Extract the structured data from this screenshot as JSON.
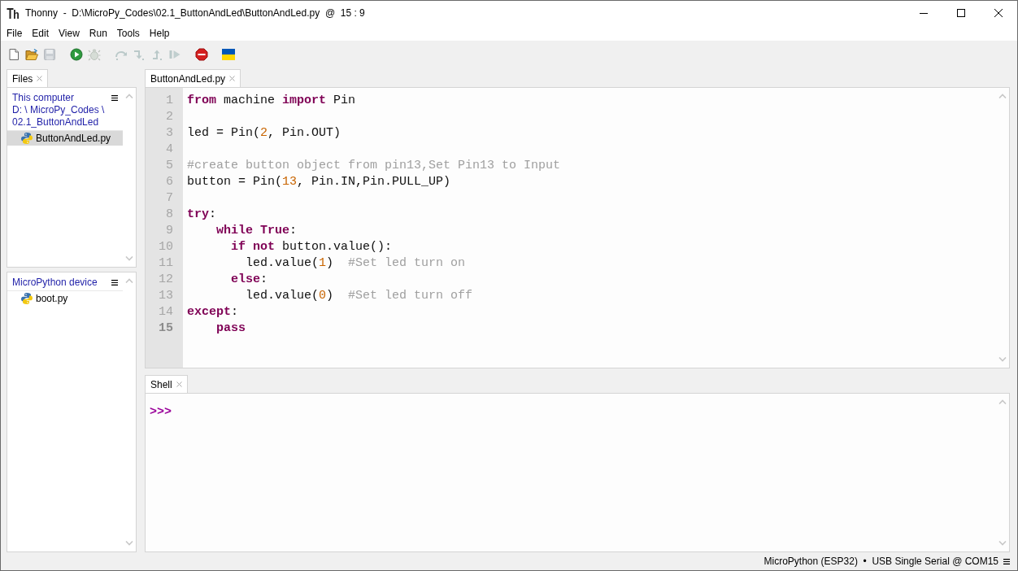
{
  "window": {
    "title": "Thonny  -  D:\\MicroPy_Codes\\02.1_ButtonAndLed\\ButtonAndLed.py  @  15 : 9"
  },
  "menu": [
    "File",
    "Edit",
    "View",
    "Run",
    "Tools",
    "Help"
  ],
  "toolbar": [
    [
      {
        "kind": "new",
        "disabled": false
      },
      {
        "kind": "open",
        "disabled": false
      },
      {
        "kind": "save",
        "disabled": true
      }
    ],
    [
      {
        "kind": "run",
        "disabled": false
      },
      {
        "kind": "debug",
        "disabled": true
      }
    ],
    [
      {
        "kind": "step_over",
        "disabled": true
      },
      {
        "kind": "step_into",
        "disabled": true
      },
      {
        "kind": "step_out",
        "disabled": true
      },
      {
        "kind": "resume",
        "disabled": true
      }
    ],
    [
      {
        "kind": "stop",
        "disabled": false
      }
    ],
    [
      {
        "kind": "flag",
        "disabled": false
      }
    ]
  ],
  "files_panel": {
    "tab": {
      "label": "Files",
      "selected": true
    },
    "sections": [
      {
        "title": "This computer",
        "path": "D: \\ MicroPy_Codes \\ 02.1_ButtonAndLed",
        "items": [
          {
            "name": "ButtonAndLed.py",
            "selected": true
          }
        ]
      },
      {
        "title": "MicroPython device",
        "items": [
          {
            "name": "boot.py",
            "selected": false
          }
        ]
      }
    ]
  },
  "editor": {
    "tabs": [
      {
        "label": "ButtonAndLed.py",
        "selected": true
      }
    ],
    "lines": [
      {
        "number": "1",
        "current": false,
        "tokens": [
          {
            "kind": "keyword",
            "text": "from"
          },
          {
            "kind": "plain",
            "text": " machine "
          },
          {
            "kind": "keyword",
            "text": "import"
          },
          {
            "kind": "plain",
            "text": " Pin"
          }
        ]
      },
      {
        "number": "2",
        "current": false
      },
      {
        "number": "3",
        "current": false,
        "tokens": [
          {
            "kind": "plain",
            "text": "led = Pin("
          },
          {
            "kind": "number",
            "text": "2"
          },
          {
            "kind": "plain",
            "text": ", Pin.OUT)"
          }
        ]
      },
      {
        "number": "4",
        "current": false
      },
      {
        "number": "5",
        "current": false,
        "tokens": [
          {
            "kind": "comment",
            "text": "#create button object from pin13,Set Pin13 to Input"
          }
        ]
      },
      {
        "number": "6",
        "current": false,
        "tokens": [
          {
            "kind": "plain",
            "text": "button = Pin("
          },
          {
            "kind": "number",
            "text": "13"
          },
          {
            "kind": "plain",
            "text": ", Pin.IN,Pin.PULL_UP)"
          }
        ]
      },
      {
        "number": "7",
        "current": false
      },
      {
        "number": "8",
        "current": false,
        "tokens": [
          {
            "kind": "keyword",
            "text": "try"
          },
          {
            "kind": "plain",
            "text": ":"
          }
        ]
      },
      {
        "number": "9",
        "current": false,
        "tokens": [
          {
            "kind": "keyword",
            "text": "    while"
          },
          {
            "kind": "keyword",
            "text": " True"
          },
          {
            "kind": "plain",
            "text": ":"
          }
        ]
      },
      {
        "number": "10",
        "current": false,
        "tokens": [
          {
            "kind": "keyword",
            "text": "      if"
          },
          {
            "kind": "keyword",
            "text": " not"
          },
          {
            "kind": "plain",
            "text": " button.value():"
          }
        ]
      },
      {
        "number": "11",
        "current": false,
        "tokens": [
          {
            "kind": "plain",
            "text": "        led.value("
          },
          {
            "kind": "number",
            "text": "1"
          },
          {
            "kind": "plain",
            "text": ")  "
          },
          {
            "kind": "comment",
            "text": "#Set led turn on"
          }
        ]
      },
      {
        "number": "12",
        "current": false,
        "tokens": [
          {
            "kind": "keyword",
            "text": "      else"
          },
          {
            "kind": "plain",
            "text": ":"
          }
        ]
      },
      {
        "number": "13",
        "current": false,
        "tokens": [
          {
            "kind": "plain",
            "text": "        led.value("
          },
          {
            "kind": "number",
            "text": "0"
          },
          {
            "kind": "plain",
            "text": ")  "
          },
          {
            "kind": "comment",
            "text": "#Set led turn off"
          }
        ]
      },
      {
        "number": "14",
        "current": false,
        "tokens": [
          {
            "kind": "keyword",
            "text": "except"
          },
          {
            "kind": "plain",
            "text": ":"
          }
        ]
      },
      {
        "number": "15",
        "current": true,
        "tokens": [
          {
            "kind": "keyword",
            "text": "    pass"
          }
        ]
      }
    ]
  },
  "shell": {
    "tab": {
      "label": "Shell",
      "selected": true
    },
    "prompt": ">>>"
  },
  "status_bar": {
    "text": "MicroPython (ESP32)  •  USB Single Serial @ COM15"
  }
}
